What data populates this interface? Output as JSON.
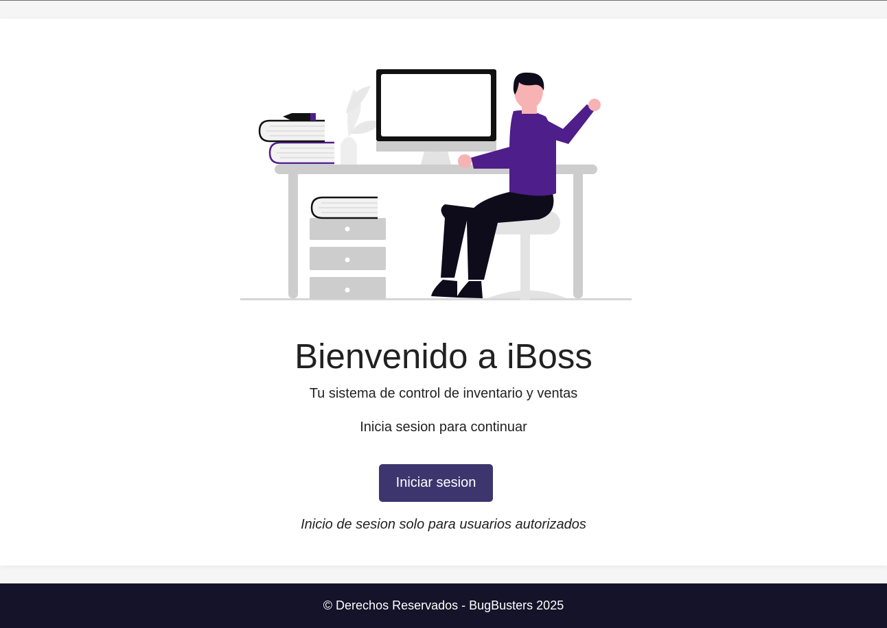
{
  "main": {
    "title": "Bienvenido a iBoss",
    "subtitle": "Tu sistema de control de inventario y ventas",
    "prompt": "Inicia sesion para continuar",
    "login_button": "Iniciar sesion",
    "note": "Inicio de sesion solo para usuarios autorizados"
  },
  "illustration": {
    "icon": "person-at-desk-illustration"
  },
  "footer": {
    "copyright": "© Derechos Reservados - BugBusters 2025"
  },
  "colors": {
    "accent": "#3d356e",
    "shirt": "#4e1e8a",
    "footer_bg": "#141329",
    "text": "#212121"
  }
}
